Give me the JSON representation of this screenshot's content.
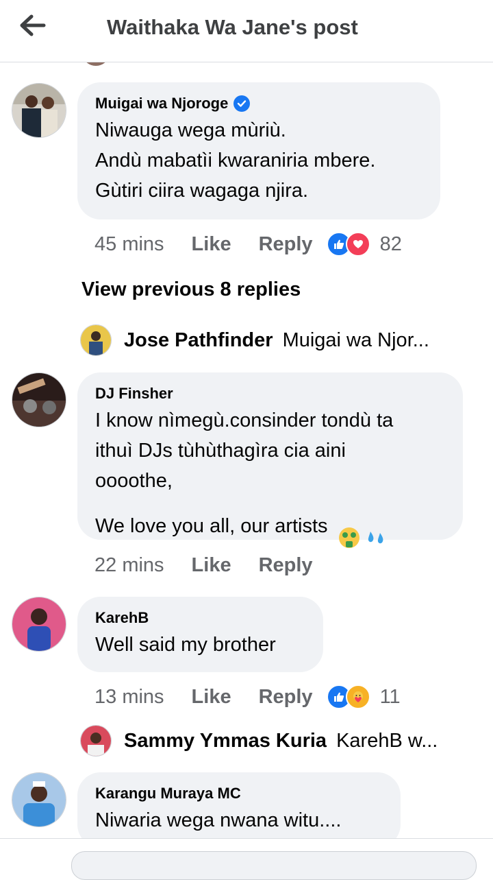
{
  "header": {
    "title": "Waithaka Wa Jane's post",
    "back_icon": "arrow-left-icon"
  },
  "comments": [
    {
      "author": "Muigai wa Njoroge",
      "verified": true,
      "text": "Niwauga wega mùriù.\nAndù mabatìi kwaraniria mbere.\nGùtiri ciira wagaga njira.",
      "time": "45 mins",
      "like": "Like",
      "reply": "Reply",
      "reactions": [
        "like-reaction-icon",
        "love-reaction-icon"
      ],
      "reaction_count": "82"
    },
    {
      "author": "DJ Finsher",
      "text": "I know nìmegù.consinder tondù ta\nithuì DJs tùhùthagìra cia aini\noooothe,\nWe love you all, our artists",
      "time": "22 mins",
      "like": "Like",
      "reply": "Reply"
    },
    {
      "author": "KarehB",
      "text": "Well said my brother",
      "time": "13 mins",
      "like": "Like",
      "reply": "Reply",
      "reactions": [
        "like-reaction-icon",
        "care-reaction-icon"
      ],
      "reaction_count": "11"
    },
    {
      "author": "Karangu Muraya MC",
      "text": "Niwaria wega nwana witu...."
    }
  ],
  "view_previous": "View previous 8 replies",
  "reply_previews": [
    {
      "name": "Jose Pathfinder",
      "text": "Muigai wa Njor..."
    },
    {
      "name": "Sammy Ymmas Kuria",
      "text": "KarehB w..."
    }
  ],
  "colors": {
    "bubble": "#f0f2f5",
    "accent": "#1877f2",
    "meta": "#65676b",
    "love": "#f33e58"
  }
}
